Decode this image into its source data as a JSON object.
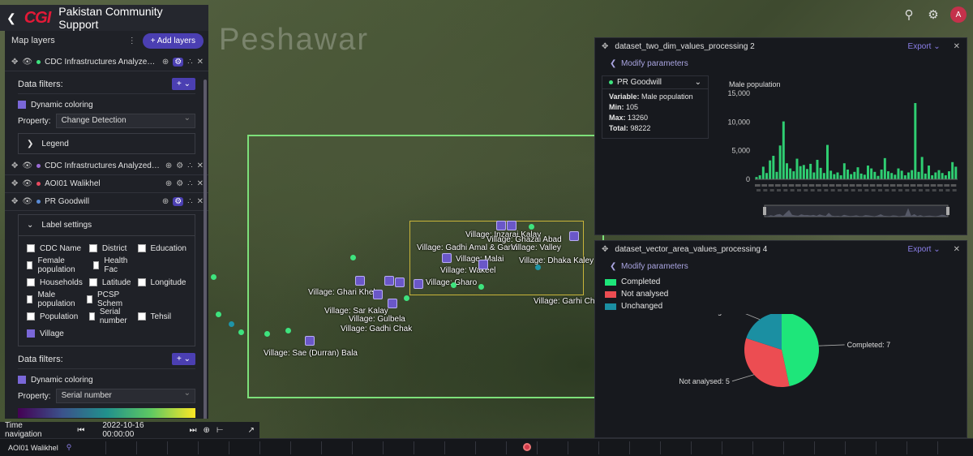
{
  "app": {
    "title": "Pakistan Community Support",
    "logo": "CGI",
    "avatar_initial": "A"
  },
  "map": {
    "city_label": "Peshawar",
    "villages": [
      {
        "label": "Village: Inzarai Kalay"
      },
      {
        "label": "Village: Ghazai Abad"
      },
      {
        "label": "Village: Gadhi Amal & Garhi"
      },
      {
        "label": "Village: Valley"
      },
      {
        "label": "Village: Malai"
      },
      {
        "label": "Village: Dhaka Kaley"
      },
      {
        "label": "Village: Wakeel"
      },
      {
        "label": "Village: Ghari Khel"
      },
      {
        "label": "Village: Gharo"
      },
      {
        "label": "Village: Sar Kalay"
      },
      {
        "label": "Village: Gulbela"
      },
      {
        "label": "Village: Garhi Chak"
      },
      {
        "label": "Village: Gadhi Chak"
      },
      {
        "label": "Village: Sae (Durran) Bala"
      }
    ]
  },
  "layers_panel": {
    "title": "Map layers",
    "add_label": "+ Add layers",
    "layers": [
      {
        "name": "CDC Infrastructures Analyzed fo...",
        "color": "#3ee37e"
      },
      {
        "name": "CDC Infrastructures Analyzed fo...",
        "color": "#9b6bd6"
      },
      {
        "name": "AOI01 Walikhel",
        "color": "#e84a5f"
      },
      {
        "name": "PR Goodwill",
        "color": "#5a8bd6"
      }
    ],
    "data_filters_label": "Data filters:",
    "filter_btn": "+ ⌄",
    "dynamic_coloring_label": "Dynamic coloring",
    "property_label": "Property:",
    "property_value_1": "Change Detection",
    "legend_label": "Legend",
    "label_settings_label": "Label settings",
    "label_options": [
      {
        "label": "CDC Name",
        "checked": false
      },
      {
        "label": "District",
        "checked": false
      },
      {
        "label": "Education",
        "checked": false
      },
      {
        "label": "Female population",
        "checked": false
      },
      {
        "label": "Health Fac",
        "checked": false
      },
      {
        "label": "Households",
        "checked": false
      },
      {
        "label": "Latitude",
        "checked": false
      },
      {
        "label": "Longitude",
        "checked": false
      },
      {
        "label": "Male population",
        "checked": false
      },
      {
        "label": "PCSP Schem",
        "checked": false
      },
      {
        "label": "Population",
        "checked": false
      },
      {
        "label": "Serial number",
        "checked": false
      },
      {
        "label": "Tehsil",
        "checked": false
      },
      {
        "label": "Village",
        "checked": true
      }
    ],
    "property_value_2": "Serial number"
  },
  "time_nav": {
    "label": "Time navigation",
    "datetime": "2022-10-16 00:00:00",
    "aoi_label": "AOI01 Walikhel"
  },
  "bar_panel": {
    "title": "dataset_two_dim_values_processing 2",
    "export_label": "Export ⌄",
    "modify_label": "Modify parameters",
    "layer_name": "PR Goodwill",
    "variable_label": "Variable:",
    "variable_value": "Male population",
    "min_label": "Min:",
    "min_value": "105",
    "max_label": "Max:",
    "max_value": "13260",
    "total_label": "Total:",
    "total_value": "98222"
  },
  "pie_panel": {
    "title": "dataset_vector_area_values_processing 4",
    "export_label": "Export ⌄",
    "modify_label": "Modify parameters"
  },
  "chart_data": [
    {
      "type": "bar",
      "ylabel": "Male population",
      "ylim": [
        0,
        15000
      ],
      "yticks": [
        "15,000",
        "10,000",
        "5,000",
        "0"
      ],
      "values": [
        400,
        700,
        2200,
        1100,
        3300,
        4100,
        1300,
        5900,
        10100,
        2800,
        1900,
        1400,
        3600,
        2300,
        2500,
        1800,
        2700,
        1200,
        3400,
        2000,
        1100,
        6000,
        1500,
        900,
        1200,
        700,
        2800,
        1700,
        900,
        1300,
        2100,
        1000,
        800,
        2400,
        1900,
        1300,
        600,
        1700,
        3700,
        1400,
        1100,
        800,
        1900,
        1500,
        700,
        1200,
        1600,
        13300,
        1300,
        3900,
        1000,
        2400,
        700,
        1200,
        1600,
        1100,
        700,
        1400,
        3000,
        2200
      ],
      "color": "#2fce72",
      "grid": false
    },
    {
      "type": "pie",
      "slices": [
        {
          "label": "Completed",
          "value": 7,
          "color": "#1ee67a"
        },
        {
          "label": "Not analysed",
          "value": 5,
          "color": "#ec4d52"
        },
        {
          "label": "Unchanged",
          "value": 3,
          "color": "#1b8fa2"
        }
      ],
      "data_labels": [
        "Completed: 7",
        "Not analysed: 5",
        "Unchanged: 3"
      ],
      "legend_position": "top-left"
    }
  ]
}
